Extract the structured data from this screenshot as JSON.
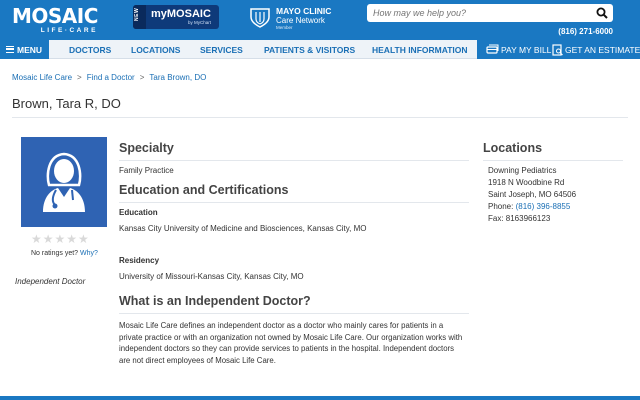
{
  "header": {
    "logo_main": "MOSAIC",
    "logo_sub": "LIFE·CARE",
    "mymosaic_new": "NEW",
    "mymosaic_brand": "myMOSAIC",
    "mymosaic_by": "by MyChart",
    "mayo_line1": "MAYO CLINIC",
    "mayo_line2": "Care Network",
    "mayo_line3": "Member",
    "search_placeholder": "How may we help you?",
    "phone": "(816) 271-6000"
  },
  "nav": {
    "menu_label": "MENU",
    "items": [
      "DOCTORS",
      "LOCATIONS",
      "SERVICES",
      "PATIENTS & VISITORS",
      "HEALTH INFORMATION"
    ],
    "pay_bill": "PAY MY BILL",
    "estimate": "GET AN ESTIMATE"
  },
  "breadcrumb": [
    "Mosaic Life Care",
    "Find a Doctor",
    "Tara Brown, DO"
  ],
  "breadcrumb_sep": ">",
  "page_title": "Brown, Tara R, DO",
  "profile": {
    "stars": "★★★★★",
    "ratings_text": "No ratings yet?",
    "ratings_link": "Why?",
    "independent_label": "Independent Doctor"
  },
  "specialty": {
    "heading": "Specialty",
    "value": "Family Practice"
  },
  "education": {
    "heading": "Education and Certifications",
    "education_label": "Education",
    "education_value": "Kansas City University of Medicine and Biosciences, Kansas City, MO",
    "residency_label": "Residency",
    "residency_value": "University of Missouri-Kansas City, Kansas City, MO"
  },
  "independent": {
    "heading": "What is an Independent Doctor?",
    "body": "Mosaic Life Care defines an independent doctor as a doctor who mainly cares for patients in a private practice or with an organization not owned by Mosaic Life Care. Our organization works with independent doctors so they can provide services to patients in the hospital. Independent doctors are not direct employees of Mosaic Life Care."
  },
  "locations": {
    "heading": "Locations",
    "name": "Downing Pediatrics",
    "street": "1918 N Woodbine Rd",
    "city": "Saint Joseph, MO 64506",
    "phone_label": "Phone:",
    "phone": "(816) 396-8855",
    "fax": "Fax: 8163966123"
  },
  "colors": {
    "brand_blue": "#1a78c2",
    "link_blue": "#1a6fb5",
    "avatar_blue": "#2f63b3"
  }
}
